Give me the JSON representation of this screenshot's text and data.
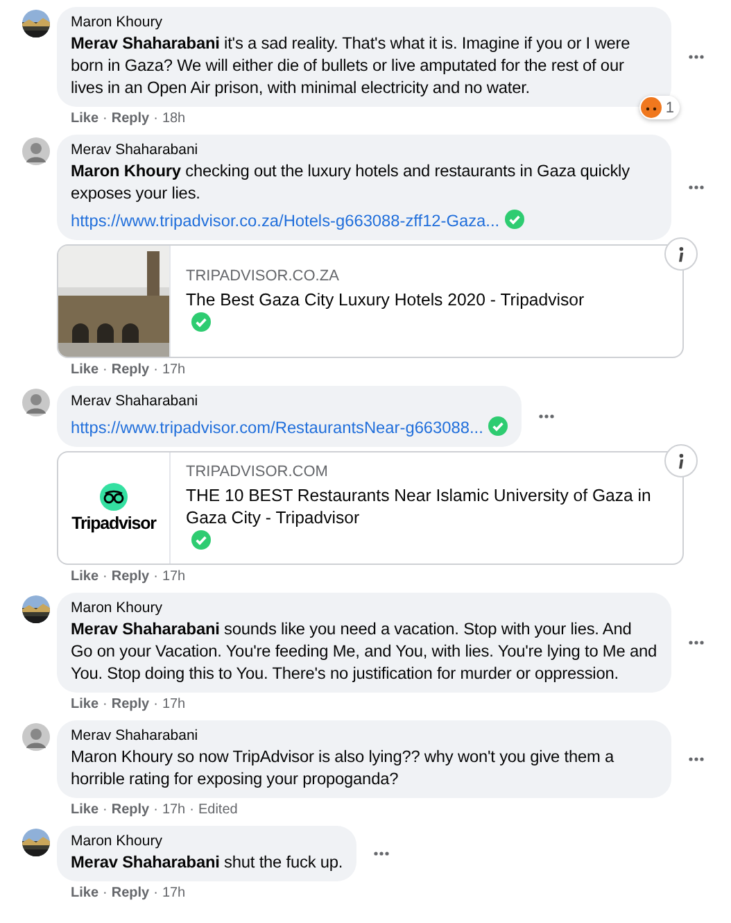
{
  "separator": "·",
  "comments": [
    {
      "author": "Maron Khoury",
      "text": "**Merav Shaharabani** it's a sad reality. That's what it is. Imagine if you or I were born in Gaza? We will either die of bullets or live amputated for the rest of our lives in an Open Air prison, with minimal electricity and no water.",
      "actions": [
        "Like",
        "Reply"
      ],
      "meta": [
        "18h"
      ],
      "reaction_count": "1"
    },
    {
      "author": "Merav Shaharabani",
      "text": "**Maron Khoury** checking out the luxury hotels and restaurants in Gaza quickly exposes your lies.",
      "link": {
        "url": "https://www.tripadvisor.co.za/Hotels-g663088-zff12-Gaza...",
        "checked": true
      },
      "card": {
        "domain": "TRIPADVISOR.CO.ZA",
        "title": "The Best Gaza City Luxury Hotels 2020 - Tripadvisor",
        "checked": true
      },
      "actions": [
        "Like",
        "Reply"
      ],
      "meta": [
        "17h"
      ]
    },
    {
      "author": "Merav Shaharabani",
      "link": {
        "url": "https://www.tripadvisor.com/RestaurantsNear-g663088...",
        "checked": true
      },
      "card": {
        "kind": "logo",
        "logo_text": "Tripadvisor",
        "domain": "TRIPADVISOR.COM",
        "title": "THE 10 BEST Restaurants Near Islamic University of Gaza in Gaza City - Tripadvisor",
        "checked": true
      },
      "actions": [
        "Like",
        "Reply"
      ],
      "meta": [
        "17h"
      ]
    },
    {
      "author": "Maron Khoury",
      "text": "**Merav Shaharabani** sounds like you need a vacation. Stop with your lies. And Go on your Vacation. You're feeding Me, and You, with lies. You're lying to Me and You. Stop doing this to You. There's no justification for murder or oppression.",
      "actions": [
        "Like",
        "Reply"
      ],
      "meta": [
        "17h"
      ]
    },
    {
      "author": "Merav Shaharabani",
      "text": "Maron Khoury so now TripAdvisor is also lying?? why won't you give them a horrible rating for exposing your propoganda?",
      "actions": [
        "Like",
        "Reply"
      ],
      "meta": [
        "17h",
        "Edited"
      ]
    },
    {
      "author": "Maron Khoury",
      "text": "**Merav Shaharabani** shut the fuck up.",
      "actions": [
        "Like",
        "Reply"
      ],
      "meta": [
        "17h"
      ]
    }
  ]
}
